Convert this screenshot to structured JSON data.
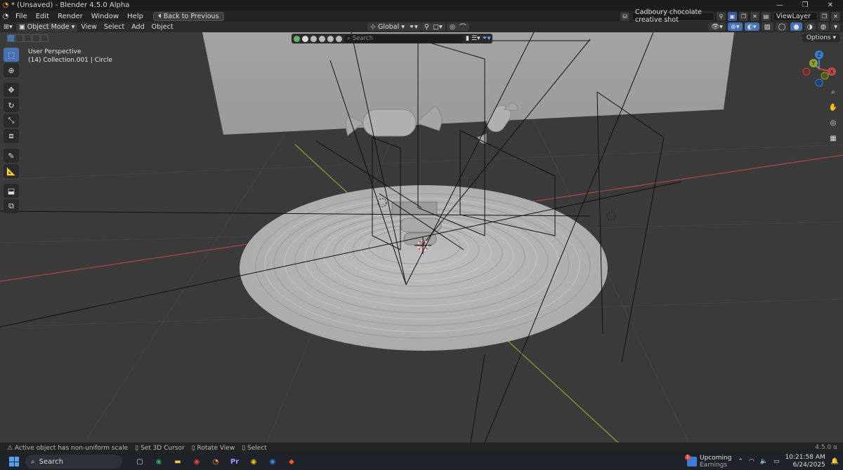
{
  "titlebar": {
    "title": "* (Unsaved) - Blender 4.5.0 Alpha",
    "minimize": "—",
    "maximize": "❐",
    "close": "✕"
  },
  "menubar": {
    "items": [
      "File",
      "Edit",
      "Render",
      "Window",
      "Help"
    ],
    "back_button": "Back to Previous",
    "scene_name": "Cadboury chocolate creative shot",
    "view_layer": "ViewLayer"
  },
  "viewport_header": {
    "mode": "Object Mode",
    "menus": [
      "View",
      "Select",
      "Add",
      "Object"
    ],
    "transform_orientation": "Global"
  },
  "viewport": {
    "perspective": "User Perspective",
    "collection_info": "(14) Collection.001 | Circle",
    "search_placeholder": "Search",
    "options_label": "Options"
  },
  "gizmo": {
    "x": "X",
    "y": "Y",
    "z": "Z"
  },
  "statusbar": {
    "items": [
      "Active object has non-uniform scale",
      "Set 3D Cursor",
      "Rotate View",
      "Select"
    ],
    "version": "4.5.0 α"
  },
  "taskbar": {
    "search": "Search",
    "news_title": "Upcoming",
    "news_sub": "Earnings",
    "news_badge": "1",
    "time": "10:21:58 AM",
    "date": "6/24/2025",
    "apps": [
      {
        "name": "task-view",
        "glyph": "▢",
        "color": "#dddddd"
      },
      {
        "name": "chrome",
        "glyph": "◉",
        "color": "#34a853"
      },
      {
        "name": "file-explorer",
        "glyph": "▬",
        "color": "#f2c94c"
      },
      {
        "name": "chrome-2",
        "glyph": "◉",
        "color": "#ea4335"
      },
      {
        "name": "blender",
        "glyph": "◔",
        "color": "#ff9b2a"
      },
      {
        "name": "premiere",
        "glyph": "Pr",
        "color": "#9999ff"
      },
      {
        "name": "chrome-3",
        "glyph": "◉",
        "color": "#fbbc05"
      },
      {
        "name": "chrome-4",
        "glyph": "◉",
        "color": "#4285f4"
      },
      {
        "name": "brave",
        "glyph": "◆",
        "color": "#fb542b"
      }
    ]
  },
  "colors": {
    "accent": "#4772b3",
    "viewport_bg": "#3b3b3b",
    "x_axis": "#c24a4a",
    "y_axis": "#8fa130"
  }
}
